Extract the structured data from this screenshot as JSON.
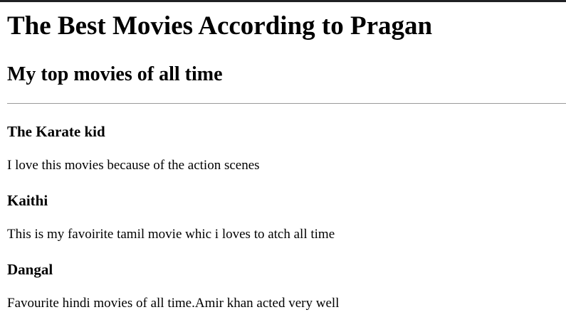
{
  "page": {
    "title": "The Best Movies According to Pragan",
    "subtitle": "My top movies of all time"
  },
  "movies": [
    {
      "title": "The Karate kid",
      "description": "I love this movies because of the action scenes"
    },
    {
      "title": "Kaithi",
      "description": "This is my favoirite tamil movie whic i loves to atch all time"
    },
    {
      "title": "Dangal",
      "description": "Favourite hindi movies of all time.Amir khan acted very well"
    }
  ]
}
